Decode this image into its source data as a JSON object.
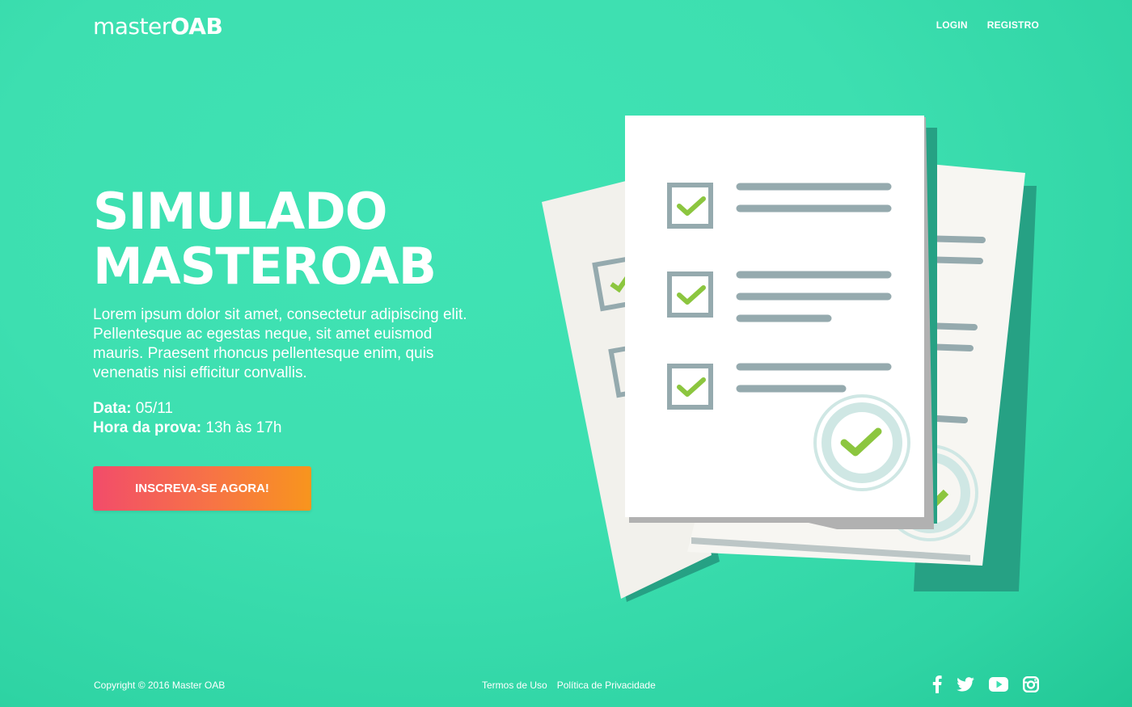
{
  "header": {
    "logo_light": "master",
    "logo_bold": "OAB",
    "nav": {
      "login": "LOGIN",
      "register": "REGISTRO"
    }
  },
  "hero": {
    "title_line1": "SIMULADO",
    "title_line2": "MASTEROAB",
    "description": "Lorem ipsum dolor sit amet, consectetur adipiscing elit. Pellentesque ac egestas neque, sit amet euismod mauris. Praesent rhoncus pellentesque enim, quis venenatis nisi efficitur convallis.",
    "date_label": "Data:",
    "date_value": "05/11",
    "time_label": "Hora da prova:",
    "time_value": "13h às 17h",
    "cta": "INSCREVA-SE AGORA!"
  },
  "illustration": {
    "icon": "checklist-documents-illustration"
  },
  "footer": {
    "copyright": "Copyright © 2016 Master OAB",
    "terms": "Termos de Uso",
    "privacy": "Política de Privacidade",
    "social": [
      "facebook-icon",
      "twitter-icon",
      "youtube-icon",
      "instagram-icon"
    ]
  },
  "colors": {
    "background": "#3ddfb0",
    "cta_start": "#f24c6a",
    "cta_end": "#f8951d",
    "check_green": "#8cc63f",
    "line_gray": "#95aaae"
  }
}
